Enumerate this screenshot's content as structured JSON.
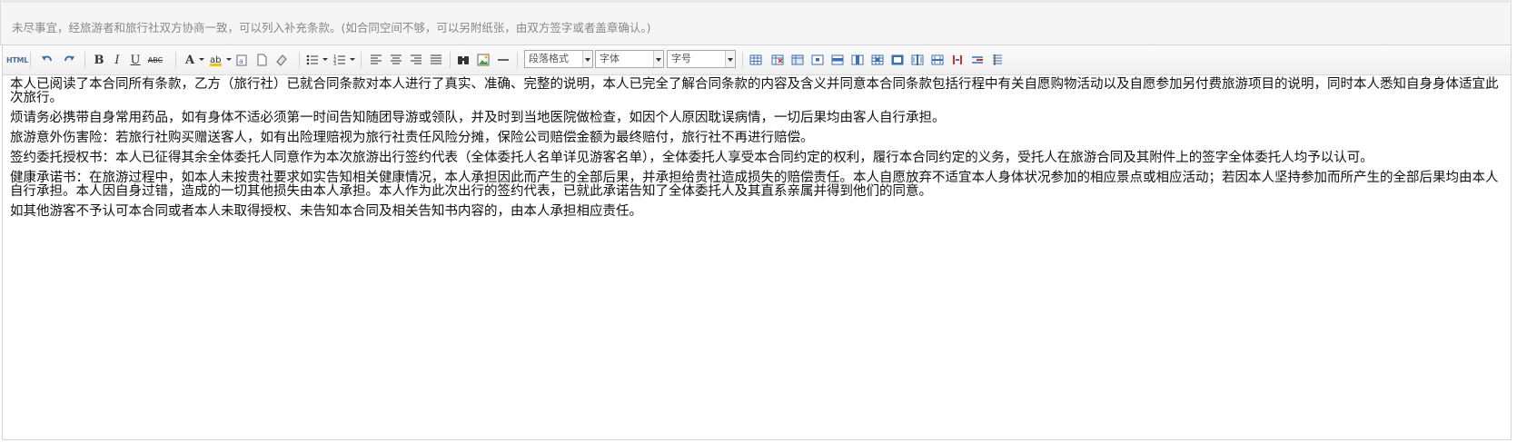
{
  "notice": {
    "text": "未尽事宜，经旅游者和旅行社双方协商一致，可以列入补充条款。(如合同空间不够，可以另附纸张，由双方签字或者盖章确认。)"
  },
  "toolbar": {
    "html_label": "HTML",
    "bold_label": "B",
    "italic_label": "I",
    "underline_label": "U",
    "strike_label": "ABC",
    "font_color_label": "A",
    "paragraph_format": "段落格式",
    "font_family": "字体",
    "font_size": "字号"
  },
  "content": {
    "paragraphs": [
      "本人已阅读了本合同所有条款，乙方（旅行社）已就合同条款对本人进行了真实、准确、完整的说明，本人已完全了解合同条款的内容及含义并同意本合同条款包括行程中有关自愿购物活动以及自愿参加另付费旅游项目的说明，同时本人悉知自身身体适宜此次旅行。",
      "烦请务必携带自身常用药品，如有身体不适必须第一时间告知随团导游或领队，并及时到当地医院做检查，如因个人原因耽误病情，一切后果均由客人自行承担。",
      "旅游意外伤害险：若旅行社购买赠送客人，如有出险理赔视为旅行社责任风险分摊，保险公司赔偿金额为最终赔付，旅行社不再进行赔偿。",
      "签约委托授权书：本人已征得其余全体委托人同意作为本次旅游出行签约代表（全体委托人名单详见游客名单），全体委托人享受本合同约定的权利，履行本合同约定的义务，受托人在旅游合同及其附件上的签字全体委托人均予以认可。",
      "健康承诺书：在旅游过程中，如本人未按贵社要求如实告知相关健康情况，本人承担因此而产生的全部后果，并承担给贵社造成损失的赔偿责任。本人自愿放弃不适宜本人身体状况参加的相应景点或相应活动；若因本人坚持参加而所产生的全部后果均由本人自行承担。本人因自身过错，造成的一切其他损失由本人承担。本人作为此次出行的签约代表，已就此承诺告知了全体委托人及其直系亲属并得到他们的同意。",
      "如其他游客不予认可本合同或者本人未取得授权、未告知本合同及相关告知书内容的，由本人承担相应责任。"
    ]
  }
}
